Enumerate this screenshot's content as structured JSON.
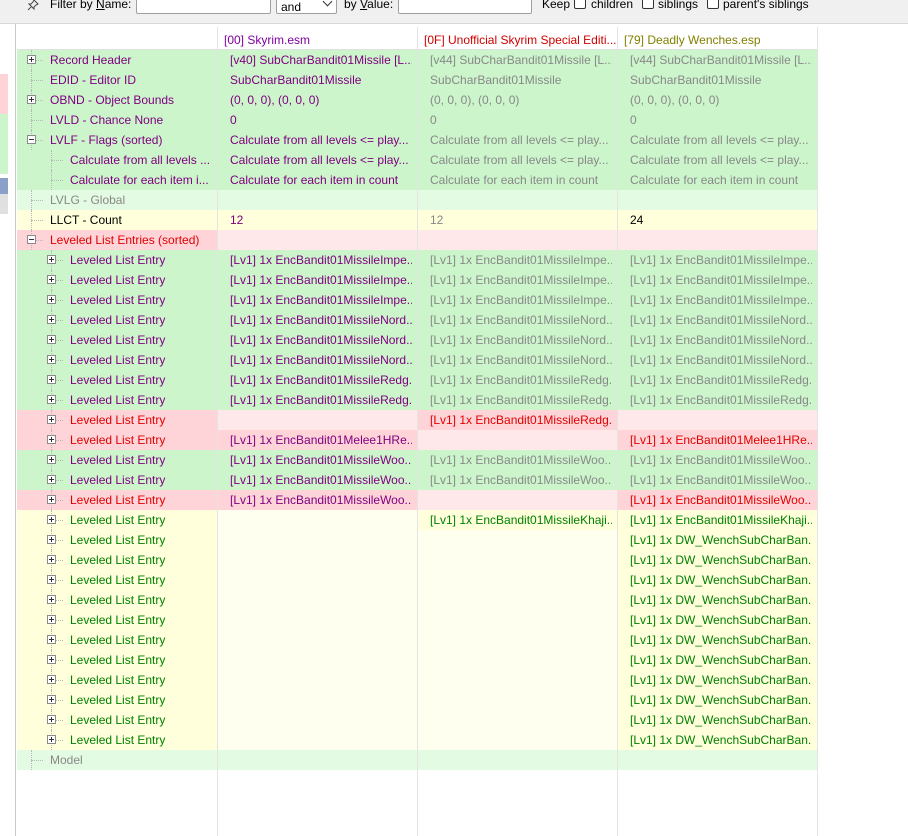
{
  "filter": {
    "name_label_pre": "Filter by ",
    "name_label_u": "N",
    "name_label_post": "ame:",
    "name_value": "",
    "operator": "and",
    "value_label_pre": "by ",
    "value_label_u": "V",
    "value_label_post": "alue:",
    "value_value": "",
    "keep_label": "Keep",
    "children_label": "children",
    "siblings_label": "siblings",
    "parents_siblings_label": "parent's siblings"
  },
  "columns": [
    "[00] Skyrim.esm",
    "[0F] Unofficial Skyrim Special Editi...",
    "[79] Deadly Wenches.esp"
  ],
  "colors": {
    "green_bg": "#ccf5cc",
    "green_bg_light": "#e3fae3",
    "red_bg": "#ffd4d8",
    "red_bg_light": "#ffe8ea",
    "yellow_bg": "#ffffdc",
    "yellow_bg_light": "#fffff0",
    "col0_header": "#8000a0",
    "col1_header": "#d00000",
    "col2_header": "#808000",
    "purple": "#800080",
    "grey": "#888888",
    "red": "#e00000",
    "green": "#008000",
    "black": "#000000"
  },
  "rows": [
    {
      "label": "Record Header",
      "depth": 0,
      "exp": "plus",
      "bg": "green",
      "lc": "purple",
      "cells": [
        [
          "[v40] SubCharBandit01Missile [L...",
          "purple"
        ],
        [
          "[v44] SubCharBandit01Missile [L...",
          "grey"
        ],
        [
          "[v44] SubCharBandit01Missile [L...",
          "grey"
        ]
      ]
    },
    {
      "label": "EDID - Editor ID",
      "depth": 0,
      "exp": "",
      "bg": "green",
      "lc": "purple",
      "cells": [
        [
          "SubCharBandit01Missile",
          "purple"
        ],
        [
          "SubCharBandit01Missile",
          "grey"
        ],
        [
          "SubCharBandit01Missile",
          "grey"
        ]
      ]
    },
    {
      "label": "OBND - Object Bounds",
      "depth": 0,
      "exp": "plus",
      "bg": "green",
      "lc": "purple",
      "cells": [
        [
          "(0, 0, 0), (0, 0, 0)",
          "purple"
        ],
        [
          "(0, 0, 0), (0, 0, 0)",
          "grey"
        ],
        [
          "(0, 0, 0), (0, 0, 0)",
          "grey"
        ]
      ]
    },
    {
      "label": "LVLD - Chance None",
      "depth": 0,
      "exp": "",
      "bg": "green",
      "lc": "purple",
      "cells": [
        [
          "0",
          "purple"
        ],
        [
          "0",
          "grey"
        ],
        [
          "0",
          "grey"
        ]
      ]
    },
    {
      "label": "LVLF - Flags (sorted)",
      "depth": 0,
      "exp": "minus",
      "bg": "green",
      "lc": "purple",
      "cells": [
        [
          "Calculate from all levels <= play...",
          "purple"
        ],
        [
          "Calculate from all levels <= play...",
          "grey"
        ],
        [
          "Calculate from all levels <= play...",
          "grey"
        ]
      ]
    },
    {
      "label": "Calculate from all levels ...",
      "depth": 1,
      "exp": "",
      "bg": "green",
      "lc": "purple",
      "cells": [
        [
          "Calculate from all levels <= play...",
          "purple"
        ],
        [
          "Calculate from all levels <= play...",
          "grey"
        ],
        [
          "Calculate from all levels <= play...",
          "grey"
        ]
      ]
    },
    {
      "label": "Calculate for each item i...",
      "depth": 1,
      "exp": "",
      "bg": "green",
      "lc": "purple",
      "cells": [
        [
          "Calculate for each item in count",
          "purple"
        ],
        [
          "Calculate for each item in count",
          "grey"
        ],
        [
          "Calculate for each item in count",
          "grey"
        ]
      ]
    },
    {
      "label": "LVLG - Global",
      "depth": 0,
      "exp": "",
      "bg": "green",
      "lc": "grey",
      "cells": [
        [
          "",
          "purple"
        ],
        [
          "",
          "grey"
        ],
        [
          "",
          "grey"
        ]
      ]
    },
    {
      "label": "LLCT - Count",
      "depth": 0,
      "exp": "",
      "bg": "yellow",
      "lc": "black",
      "cells": [
        [
          "12",
          "purple"
        ],
        [
          "12",
          "grey"
        ],
        [
          "24",
          "black"
        ]
      ]
    },
    {
      "label": "Leveled List Entries (sorted)",
      "depth": 0,
      "exp": "minus",
      "bg": "red",
      "lc": "red",
      "cells": [
        [
          "",
          "purple"
        ],
        [
          "",
          "grey"
        ],
        [
          "",
          "grey"
        ]
      ]
    },
    {
      "label": "Leveled List Entry",
      "depth": 1,
      "exp": "plus",
      "bg": "green",
      "lc": "purple",
      "cells": [
        [
          "[Lv1] 1x EncBandit01MissileImpe...",
          "purple"
        ],
        [
          "[Lv1] 1x EncBandit01MissileImpe...",
          "grey"
        ],
        [
          "[Lv1] 1x EncBandit01MissileImpe...",
          "grey"
        ]
      ]
    },
    {
      "label": "Leveled List Entry",
      "depth": 1,
      "exp": "plus",
      "bg": "green",
      "lc": "purple",
      "cells": [
        [
          "[Lv1] 1x EncBandit01MissileImpe...",
          "purple"
        ],
        [
          "[Lv1] 1x EncBandit01MissileImpe...",
          "grey"
        ],
        [
          "[Lv1] 1x EncBandit01MissileImpe...",
          "grey"
        ]
      ]
    },
    {
      "label": "Leveled List Entry",
      "depth": 1,
      "exp": "plus",
      "bg": "green",
      "lc": "purple",
      "cells": [
        [
          "[Lv1] 1x EncBandit01MissileImpe...",
          "purple"
        ],
        [
          "[Lv1] 1x EncBandit01MissileImpe...",
          "grey"
        ],
        [
          "[Lv1] 1x EncBandit01MissileImpe...",
          "grey"
        ]
      ]
    },
    {
      "label": "Leveled List Entry",
      "depth": 1,
      "exp": "plus",
      "bg": "green",
      "lc": "purple",
      "cells": [
        [
          "[Lv1] 1x EncBandit01MissileNord...",
          "purple"
        ],
        [
          "[Lv1] 1x EncBandit01MissileNord...",
          "grey"
        ],
        [
          "[Lv1] 1x EncBandit01MissileNord...",
          "grey"
        ]
      ]
    },
    {
      "label": "Leveled List Entry",
      "depth": 1,
      "exp": "plus",
      "bg": "green",
      "lc": "purple",
      "cells": [
        [
          "[Lv1] 1x EncBandit01MissileNord...",
          "purple"
        ],
        [
          "[Lv1] 1x EncBandit01MissileNord...",
          "grey"
        ],
        [
          "[Lv1] 1x EncBandit01MissileNord...",
          "grey"
        ]
      ]
    },
    {
      "label": "Leveled List Entry",
      "depth": 1,
      "exp": "plus",
      "bg": "green",
      "lc": "purple",
      "cells": [
        [
          "[Lv1] 1x EncBandit01MissileNord...",
          "purple"
        ],
        [
          "[Lv1] 1x EncBandit01MissileNord...",
          "grey"
        ],
        [
          "[Lv1] 1x EncBandit01MissileNord...",
          "grey"
        ]
      ]
    },
    {
      "label": "Leveled List Entry",
      "depth": 1,
      "exp": "plus",
      "bg": "green",
      "lc": "purple",
      "cells": [
        [
          "[Lv1] 1x EncBandit01MissileRedg...",
          "purple"
        ],
        [
          "[Lv1] 1x EncBandit01MissileRedg...",
          "grey"
        ],
        [
          "[Lv1] 1x EncBandit01MissileRedg...",
          "grey"
        ]
      ]
    },
    {
      "label": "Leveled List Entry",
      "depth": 1,
      "exp": "plus",
      "bg": "green",
      "lc": "purple",
      "cells": [
        [
          "[Lv1] 1x EncBandit01MissileRedg...",
          "purple"
        ],
        [
          "[Lv1] 1x EncBandit01MissileRedg...",
          "grey"
        ],
        [
          "[Lv1] 1x EncBandit01MissileRedg...",
          "grey"
        ]
      ]
    },
    {
      "label": "Leveled List Entry",
      "depth": 1,
      "exp": "plus",
      "bg": "red",
      "lc": "red",
      "cells": [
        [
          "",
          "purple"
        ],
        [
          "[Lv1] 1x EncBandit01MissileRedg...",
          "red"
        ],
        [
          "",
          "grey"
        ]
      ]
    },
    {
      "label": "Leveled List Entry",
      "depth": 1,
      "exp": "plus",
      "bg": "red",
      "lc": "red",
      "cells": [
        [
          "[Lv1] 1x EncBandit01Melee1HRe...",
          "purple"
        ],
        [
          "",
          "grey"
        ],
        [
          "[Lv1] 1x EncBandit01Melee1HRe...",
          "red"
        ]
      ]
    },
    {
      "label": "Leveled List Entry",
      "depth": 1,
      "exp": "plus",
      "bg": "green",
      "lc": "purple",
      "cells": [
        [
          "[Lv1] 1x EncBandit01MissileWoo...",
          "purple"
        ],
        [
          "[Lv1] 1x EncBandit01MissileWoo...",
          "grey"
        ],
        [
          "[Lv1] 1x EncBandit01MissileWoo...",
          "grey"
        ]
      ]
    },
    {
      "label": "Leveled List Entry",
      "depth": 1,
      "exp": "plus",
      "bg": "green",
      "lc": "purple",
      "cells": [
        [
          "[Lv1] 1x EncBandit01MissileWoo...",
          "purple"
        ],
        [
          "[Lv1] 1x EncBandit01MissileWoo...",
          "grey"
        ],
        [
          "[Lv1] 1x EncBandit01MissileWoo...",
          "grey"
        ]
      ]
    },
    {
      "label": "Leveled List Entry",
      "depth": 1,
      "exp": "plus",
      "bg": "red",
      "lc": "red",
      "cells": [
        [
          "[Lv1] 1x EncBandit01MissileWoo...",
          "purple"
        ],
        [
          "",
          "grey"
        ],
        [
          "[Lv1] 1x EncBandit01MissileWoo...",
          "red"
        ]
      ]
    },
    {
      "label": "Leveled List Entry",
      "depth": 1,
      "exp": "plus",
      "bg": "yellow",
      "lc": "green",
      "cells": [
        [
          "",
          "purple"
        ],
        [
          "[Lv1] 1x EncBandit01MissileKhaji...",
          "green"
        ],
        [
          "[Lv1] 1x EncBandit01MissileKhaji...",
          "green"
        ]
      ]
    },
    {
      "label": "Leveled List Entry",
      "depth": 1,
      "exp": "plus",
      "bg": "yellow",
      "lc": "green",
      "cells": [
        [
          "",
          "purple"
        ],
        [
          "",
          "grey"
        ],
        [
          "[Lv1] 1x DW_WenchSubCharBan...",
          "green"
        ]
      ]
    },
    {
      "label": "Leveled List Entry",
      "depth": 1,
      "exp": "plus",
      "bg": "yellow",
      "lc": "green",
      "cells": [
        [
          "",
          "purple"
        ],
        [
          "",
          "grey"
        ],
        [
          "[Lv1] 1x DW_WenchSubCharBan...",
          "green"
        ]
      ]
    },
    {
      "label": "Leveled List Entry",
      "depth": 1,
      "exp": "plus",
      "bg": "yellow",
      "lc": "green",
      "cells": [
        [
          "",
          "purple"
        ],
        [
          "",
          "grey"
        ],
        [
          "[Lv1] 1x DW_WenchSubCharBan...",
          "green"
        ]
      ]
    },
    {
      "label": "Leveled List Entry",
      "depth": 1,
      "exp": "plus",
      "bg": "yellow",
      "lc": "green",
      "cells": [
        [
          "",
          "purple"
        ],
        [
          "",
          "grey"
        ],
        [
          "[Lv1] 1x DW_WenchSubCharBan...",
          "green"
        ]
      ]
    },
    {
      "label": "Leveled List Entry",
      "depth": 1,
      "exp": "plus",
      "bg": "yellow",
      "lc": "green",
      "cells": [
        [
          "",
          "purple"
        ],
        [
          "",
          "grey"
        ],
        [
          "[Lv1] 1x DW_WenchSubCharBan...",
          "green"
        ]
      ]
    },
    {
      "label": "Leveled List Entry",
      "depth": 1,
      "exp": "plus",
      "bg": "yellow",
      "lc": "green",
      "cells": [
        [
          "",
          "purple"
        ],
        [
          "",
          "grey"
        ],
        [
          "[Lv1] 1x DW_WenchSubCharBan...",
          "green"
        ]
      ]
    },
    {
      "label": "Leveled List Entry",
      "depth": 1,
      "exp": "plus",
      "bg": "yellow",
      "lc": "green",
      "cells": [
        [
          "",
          "purple"
        ],
        [
          "",
          "grey"
        ],
        [
          "[Lv1] 1x DW_WenchSubCharBan...",
          "green"
        ]
      ]
    },
    {
      "label": "Leveled List Entry",
      "depth": 1,
      "exp": "plus",
      "bg": "yellow",
      "lc": "green",
      "cells": [
        [
          "",
          "purple"
        ],
        [
          "",
          "grey"
        ],
        [
          "[Lv1] 1x DW_WenchSubCharBan...",
          "green"
        ]
      ]
    },
    {
      "label": "Leveled List Entry",
      "depth": 1,
      "exp": "plus",
      "bg": "yellow",
      "lc": "green",
      "cells": [
        [
          "",
          "purple"
        ],
        [
          "",
          "grey"
        ],
        [
          "[Lv1] 1x DW_WenchSubCharBan...",
          "green"
        ]
      ]
    },
    {
      "label": "Leveled List Entry",
      "depth": 1,
      "exp": "plus",
      "bg": "yellow",
      "lc": "green",
      "cells": [
        [
          "",
          "purple"
        ],
        [
          "",
          "grey"
        ],
        [
          "[Lv1] 1x DW_WenchSubCharBan...",
          "green"
        ]
      ]
    },
    {
      "label": "Leveled List Entry",
      "depth": 1,
      "exp": "plus",
      "bg": "yellow",
      "lc": "green",
      "cells": [
        [
          "",
          "purple"
        ],
        [
          "",
          "grey"
        ],
        [
          "[Lv1] 1x DW_WenchSubCharBan...",
          "green"
        ]
      ]
    },
    {
      "label": "Model",
      "depth": 0,
      "exp": "",
      "bg": "green",
      "lc": "grey",
      "cells": [
        [
          "",
          "purple"
        ],
        [
          "",
          "grey"
        ],
        [
          "",
          "grey"
        ]
      ]
    }
  ]
}
